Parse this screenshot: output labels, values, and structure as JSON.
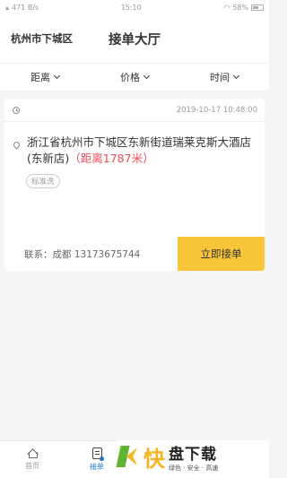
{
  "status_bar": {
    "network_speed": "471 B/s",
    "time": "15:10",
    "battery": "58%"
  },
  "header": {
    "city": "杭州市下城区",
    "title": "接单大厅"
  },
  "filters": [
    {
      "label": "距离"
    },
    {
      "label": "价格"
    },
    {
      "label": "时间"
    }
  ],
  "order": {
    "datetime": "2019-10-17 10:48:00",
    "address": "浙江省杭州市下城区东新街道瑞莱克斯大酒店(东新店)",
    "distance": "（距离1787米）",
    "tag": "标准洗",
    "contact": "联系：成都  13173675744",
    "accept_label": "立即接单"
  },
  "tabbar": {
    "home_label": "首页",
    "orders_label": "接单"
  },
  "watermark": {
    "logo_char": "快",
    "main": "盘下载",
    "sub": "绿色 · 安全 · 高速"
  },
  "colors": {
    "accent": "#f8c438",
    "distance": "#f04b5a",
    "active_tab": "#1b77c5"
  }
}
